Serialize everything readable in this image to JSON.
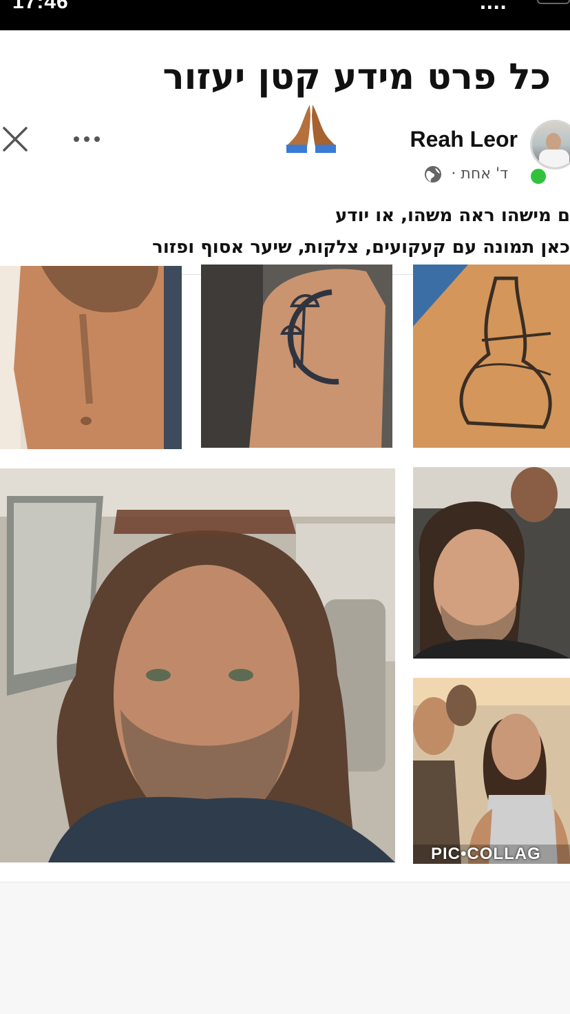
{
  "status_bar": {
    "time": "17:46",
    "signal": "...."
  },
  "post": {
    "headline": "כל פרט מידע קטן יעזור",
    "author": "Reah Leor",
    "meta": "ד' אחת ·",
    "body_lines": [
      "ם מישהו ראה משהו, או יודע",
      "כאן תמונה עם קעקועים, צלקות, שיער אסוף ופזור"
    ],
    "online_status_color": "#31c23c"
  },
  "icons": {
    "close": "close-icon",
    "more": "more-options-icon",
    "pray": "folded-hands-emoji-icon",
    "globe": "globe-icon"
  },
  "collage": {
    "photos": [
      {
        "subject": "shirtless-torso-photo"
      },
      {
        "subject": "arm-mushroom-moon-tattoo-photo"
      },
      {
        "subject": "shoulder-tattoo-photo"
      },
      {
        "subject": "car-selfie-photo"
      },
      {
        "subject": "portrait-photo"
      },
      {
        "subject": "group-photo"
      }
    ],
    "watermark": "PIC•COLLAG"
  }
}
